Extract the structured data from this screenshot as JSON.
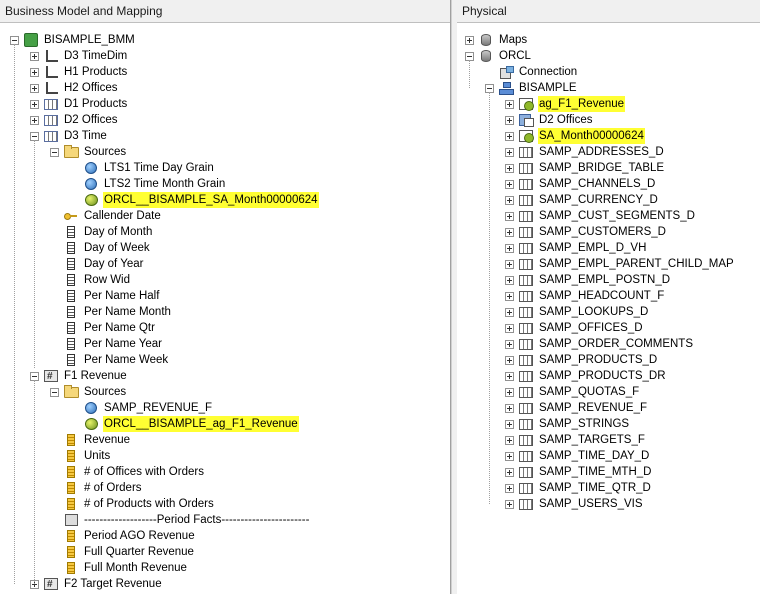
{
  "left_panel": {
    "title": "Business Model and Mapping",
    "root": "BISAMPLE_BMM",
    "dimensions": [
      {
        "label": "D3 TimeDim",
        "icon": "dimension-hierarchy-icon"
      },
      {
        "label": "H1 Products",
        "icon": "dimension-hierarchy-icon"
      },
      {
        "label": "H2 Offices",
        "icon": "dimension-hierarchy-icon"
      },
      {
        "label": "D1 Products",
        "icon": "logical-table-icon"
      },
      {
        "label": "D2 Offices",
        "icon": "logical-table-icon"
      },
      {
        "label": "D3 Time",
        "icon": "logical-table-icon"
      }
    ],
    "d3_time": {
      "sources_label": "Sources",
      "sources": [
        {
          "label": "LTS1 Time Day Grain",
          "icon": "logical-table-source-icon",
          "highlighted": false
        },
        {
          "label": "LTS2 Time Month Grain",
          "icon": "logical-table-source-icon",
          "highlighted": false
        },
        {
          "label": "ORCL__BISAMPLE_SA_Month00000624",
          "icon": "aggregate-source-icon",
          "highlighted": true
        }
      ],
      "columns": [
        {
          "label": "Callender Date",
          "icon": "key-icon"
        },
        {
          "label": "Day of Month",
          "icon": "column-icon"
        },
        {
          "label": "Day of Week",
          "icon": "column-icon"
        },
        {
          "label": "Day of Year",
          "icon": "column-icon"
        },
        {
          "label": "Row Wid",
          "icon": "column-icon"
        },
        {
          "label": "Per Name Half",
          "icon": "column-icon"
        },
        {
          "label": "Per Name Month",
          "icon": "column-icon"
        },
        {
          "label": "Per Name Qtr",
          "icon": "column-icon"
        },
        {
          "label": "Per Name Year",
          "icon": "column-icon"
        },
        {
          "label": "Per Name Week",
          "icon": "column-icon"
        }
      ]
    },
    "f1_revenue": {
      "label": "F1 Revenue",
      "sources_label": "Sources",
      "sources": [
        {
          "label": "SAMP_REVENUE_F",
          "icon": "logical-table-source-icon",
          "highlighted": false
        },
        {
          "label": "ORCL__BISAMPLE_ag_F1_Revenue",
          "icon": "aggregate-source-icon",
          "highlighted": true
        }
      ],
      "measures": [
        {
          "label": "Revenue",
          "icon": "measure-icon"
        },
        {
          "label": "Units",
          "icon": "measure-icon"
        },
        {
          "label": "# of Offices with Orders",
          "icon": "measure-icon"
        },
        {
          "label": "# of Orders",
          "icon": "measure-icon"
        },
        {
          "label": "# of Products with Orders",
          "icon": "measure-icon"
        },
        {
          "label": "-------------------Period Facts-----------------------",
          "icon": "separator-icon"
        },
        {
          "label": "Period AGO Revenue",
          "icon": "measure-icon"
        },
        {
          "label": "Full Quarter Revenue",
          "icon": "measure-icon"
        },
        {
          "label": "Full Month Revenue",
          "icon": "measure-icon"
        }
      ]
    },
    "f2_label": "F2 Target Revenue"
  },
  "right_panel": {
    "title": "Physical",
    "maps_label": "Maps",
    "orcl_label": "ORCL",
    "connection_label": "Connection",
    "schema_label": "BISAMPLE",
    "tables": [
      {
        "label": "ag_F1_Revenue",
        "icon": "aggregate-table-icon",
        "highlighted": true
      },
      {
        "label": "D2 Offices",
        "icon": "alias-table-icon",
        "highlighted": false
      },
      {
        "label": "SA_Month00000624",
        "icon": "aggregate-table-icon",
        "highlighted": true
      },
      {
        "label": "SAMP_ADDRESSES_D",
        "icon": "physical-table-icon",
        "highlighted": false
      },
      {
        "label": "SAMP_BRIDGE_TABLE",
        "icon": "physical-table-icon",
        "highlighted": false
      },
      {
        "label": "SAMP_CHANNELS_D",
        "icon": "physical-table-icon",
        "highlighted": false
      },
      {
        "label": "SAMP_CURRENCY_D",
        "icon": "physical-table-icon",
        "highlighted": false
      },
      {
        "label": "SAMP_CUST_SEGMENTS_D",
        "icon": "physical-table-icon",
        "highlighted": false
      },
      {
        "label": "SAMP_CUSTOMERS_D",
        "icon": "physical-table-icon",
        "highlighted": false
      },
      {
        "label": "SAMP_EMPL_D_VH",
        "icon": "physical-table-icon",
        "highlighted": false
      },
      {
        "label": "SAMP_EMPL_PARENT_CHILD_MAP",
        "icon": "physical-table-icon",
        "highlighted": false
      },
      {
        "label": "SAMP_EMPL_POSTN_D",
        "icon": "physical-table-icon",
        "highlighted": false
      },
      {
        "label": "SAMP_HEADCOUNT_F",
        "icon": "physical-table-icon",
        "highlighted": false
      },
      {
        "label": "SAMP_LOOKUPS_D",
        "icon": "physical-table-icon",
        "highlighted": false
      },
      {
        "label": "SAMP_OFFICES_D",
        "icon": "physical-table-icon",
        "highlighted": false
      },
      {
        "label": "SAMP_ORDER_COMMENTS",
        "icon": "physical-table-icon",
        "highlighted": false
      },
      {
        "label": "SAMP_PRODUCTS_D",
        "icon": "physical-table-icon",
        "highlighted": false
      },
      {
        "label": "SAMP_PRODUCTS_DR",
        "icon": "physical-table-icon",
        "highlighted": false
      },
      {
        "label": "SAMP_QUOTAS_F",
        "icon": "physical-table-icon",
        "highlighted": false
      },
      {
        "label": "SAMP_REVENUE_F",
        "icon": "physical-table-icon",
        "highlighted": false
      },
      {
        "label": "SAMP_STRINGS",
        "icon": "physical-table-icon",
        "highlighted": false
      },
      {
        "label": "SAMP_TARGETS_F",
        "icon": "physical-table-icon",
        "highlighted": false
      },
      {
        "label": "SAMP_TIME_DAY_D",
        "icon": "physical-table-icon",
        "highlighted": false
      },
      {
        "label": "SAMP_TIME_MTH_D",
        "icon": "physical-table-icon",
        "highlighted": false
      },
      {
        "label": "SAMP_TIME_QTR_D",
        "icon": "physical-table-icon",
        "highlighted": false
      },
      {
        "label": "SAMP_USERS_VIS",
        "icon": "physical-table-icon",
        "highlighted": false
      }
    ]
  },
  "colors": {
    "highlight": "#ffff33",
    "panel_header": "#f0f0f0"
  }
}
